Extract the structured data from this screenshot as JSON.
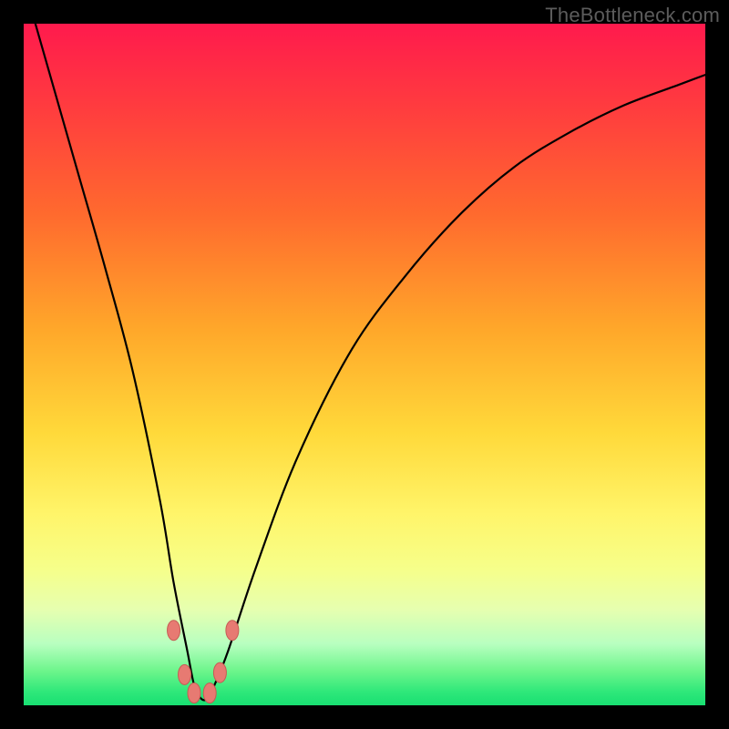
{
  "watermark": "TheBottleneck.com",
  "chart_data": {
    "type": "line",
    "title": "",
    "xlabel": "",
    "ylabel": "",
    "xlim": [
      0,
      100
    ],
    "ylim": [
      0,
      100
    ],
    "background_gradient": {
      "top": "#ff1a4d",
      "upper_mid": "#ffa82a",
      "mid": "#fff56a",
      "lower_mid": "#b8ffc0",
      "bottom": "#18df72"
    },
    "series": [
      {
        "name": "bottleneck-curve",
        "x": [
          0,
          4,
          8,
          12,
          16,
          20,
          22,
          24,
          25,
          26,
          27,
          28,
          30,
          34,
          40,
          48,
          56,
          64,
          72,
          80,
          88,
          96,
          100
        ],
        "y": [
          106,
          92,
          78,
          64,
          49,
          30,
          18,
          8,
          3,
          1,
          1,
          3,
          8,
          20,
          36,
          52,
          63,
          72,
          79,
          84,
          88,
          91,
          92.5
        ]
      }
    ],
    "markers": [
      {
        "name": "left-upper",
        "x": 22.0,
        "y": 11.0
      },
      {
        "name": "left-lower",
        "x": 23.6,
        "y": 4.5
      },
      {
        "name": "bottom-left",
        "x": 25.0,
        "y": 1.8
      },
      {
        "name": "bottom-right",
        "x": 27.3,
        "y": 1.8
      },
      {
        "name": "right-lower",
        "x": 28.8,
        "y": 4.8
      },
      {
        "name": "right-upper",
        "x": 30.6,
        "y": 11.0
      }
    ],
    "marker_style": {
      "fill": "#e77a72",
      "rx": 7,
      "ry": 11,
      "stroke": "#c65b54"
    }
  }
}
